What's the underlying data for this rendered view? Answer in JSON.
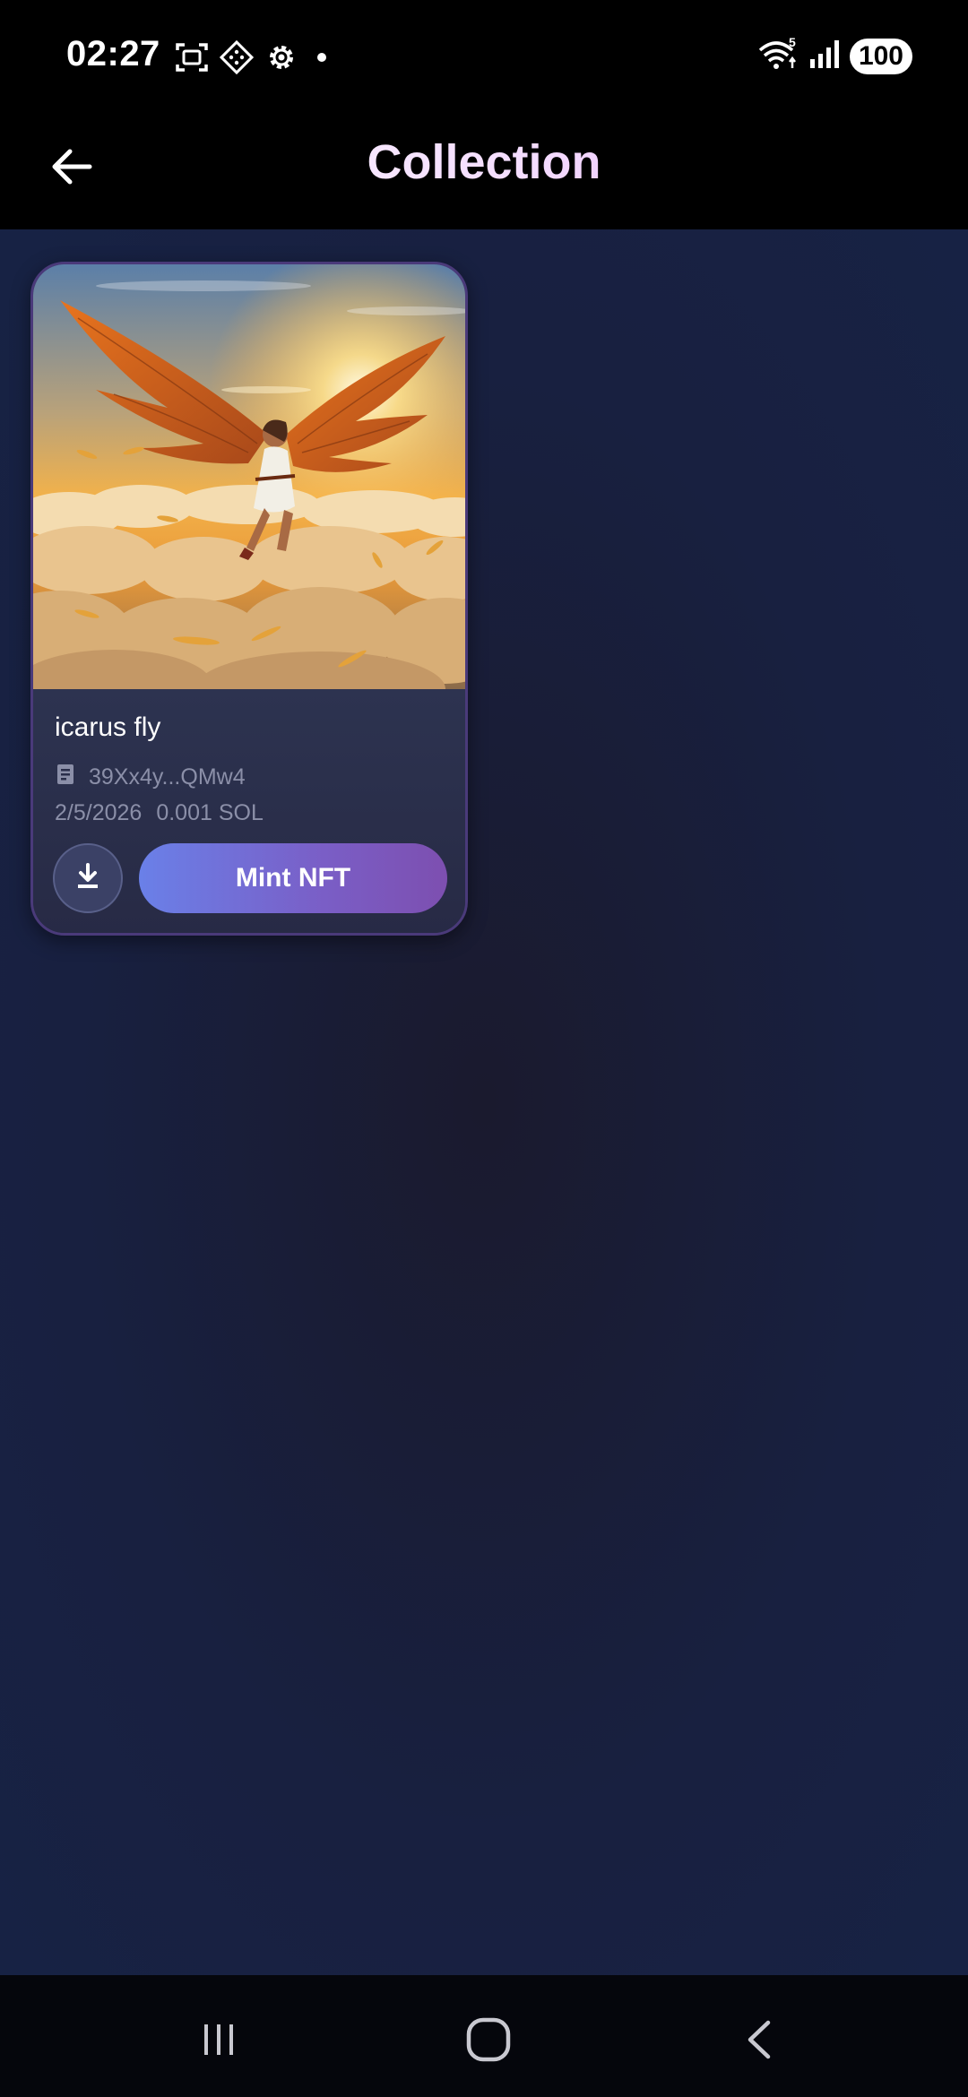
{
  "status_bar": {
    "time": "02:27",
    "icons_left": [
      "screenshot-icon",
      "diamond-app-icon",
      "gear-icon",
      "dot-icon"
    ],
    "icons_right": [
      "wifi-icon",
      "signal-icon"
    ],
    "wifi_label": "5",
    "battery": "100"
  },
  "app_bar": {
    "back_icon": "arrow-left-icon",
    "title": "Collection"
  },
  "collection": {
    "items": [
      {
        "image_alt": "icarus fly",
        "title": "icarus fly",
        "wallet": "39Xx4y...QMw4",
        "date": "2/5/2026",
        "price": "0.001 SOL",
        "download_icon": "download-icon",
        "mint_label": "Mint NFT"
      }
    ]
  },
  "colors": {
    "background": "#182040",
    "card": "#2a2e4a",
    "card_border": "#4a3a7a",
    "mint_gradient_start": "#6a80e8",
    "mint_gradient_end": "#7d4fb0",
    "title_gradient_end": "#e9a6f5",
    "muted_text": "#8b8fa8"
  },
  "nav_bar": {
    "icons": [
      "recents-icon",
      "home-icon",
      "back-icon"
    ]
  }
}
